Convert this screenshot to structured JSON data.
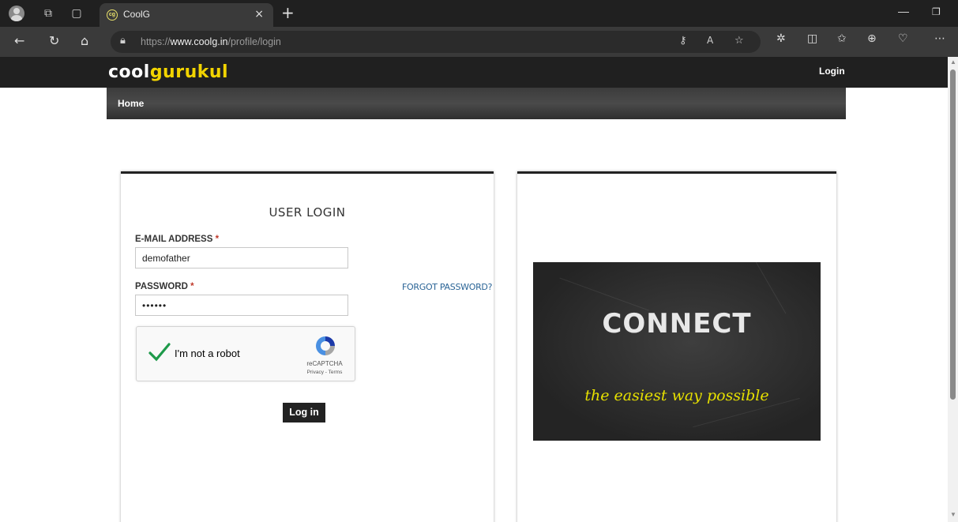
{
  "browser": {
    "tab_title": "CoolG",
    "tab_favicon": "cg",
    "tab_close": "×",
    "new_tab": "+",
    "url_prefix": "https://",
    "url_domain": "www.coolg.in",
    "url_path": "/profile/login"
  },
  "site": {
    "logo_part1": "cool",
    "logo_part2": "gurukul",
    "header_login": "Login",
    "nav_home": "Home"
  },
  "login_form": {
    "title": "USER LOGIN",
    "email_label": "E-MAIL ADDRESS",
    "email_value": "demofather",
    "password_label": "PASSWORD",
    "password_value": "••••••",
    "required_mark": "*",
    "forgot_password": "FORGOT PASSWORD?",
    "submit_label": "Log in"
  },
  "recaptcha": {
    "label": "I'm not a robot",
    "brand": "reCAPTCHA",
    "links": "Privacy - Terms",
    "checked": true
  },
  "promo": {
    "headline": "CONNECT",
    "tagline": "the easiest way possible"
  },
  "colors": {
    "header_bg": "#202020",
    "logo_accent": "#f2d400",
    "link_blue": "#2a6496",
    "required_red": "#c0392b",
    "promo_tagline": "#e6e000"
  },
  "icons": {
    "profile": "profile-icon",
    "workspaces": "workspaces-icon",
    "tab_actions": "tab-actions-icon",
    "back": "back-icon",
    "refresh": "refresh-icon",
    "home": "home-icon",
    "lock": "lock-icon",
    "read_aloud": "read-aloud-icon",
    "favorite": "favorite-icon",
    "extensions": "extensions-icon",
    "split_screen": "split-screen-icon",
    "favorites": "favorites-icon",
    "collections": "collections-icon",
    "performance": "performance-icon",
    "more": "more-icon"
  }
}
